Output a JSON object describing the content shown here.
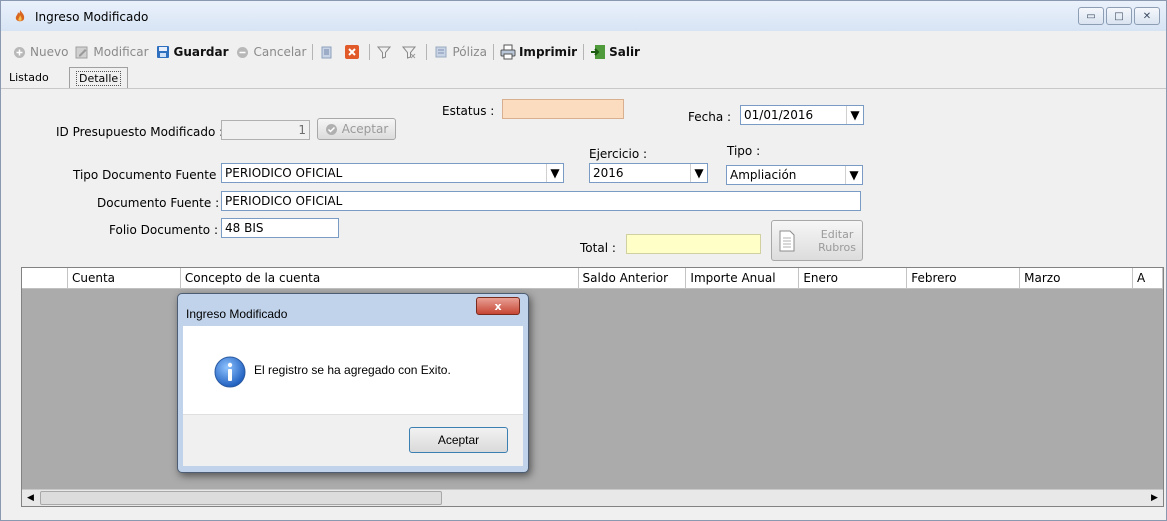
{
  "window": {
    "title": "Ingreso Modificado",
    "icon": "app-flame-icon"
  },
  "toolbar": {
    "nuevo": "Nuevo",
    "modificar": "Modificar",
    "guardar": "Guardar",
    "cancelar": "Cancelar",
    "poliza": "Póliza",
    "imprimir": "Imprimir",
    "salir": "Salir"
  },
  "tabs": {
    "listado": "Listado",
    "detalle": "Detalle"
  },
  "form": {
    "estatus_label": "Estatus :",
    "estatus_value": "",
    "fecha_label": "Fecha :",
    "fecha_value": "01/01/2016",
    "id_label": "ID Presupuesto Modificado :",
    "id_value": "1",
    "aceptar_label": "Aceptar",
    "tipo_doc_label": "Tipo Documento Fuente :",
    "tipo_doc_value": "PERIODICO OFICIAL",
    "ejercicio_label": "Ejercicio :",
    "ejercicio_value": "2016",
    "tipo_label": "Tipo :",
    "tipo_value": "Ampliación",
    "doc_fuente_label": "Documento Fuente :",
    "doc_fuente_value": "PERIODICO OFICIAL",
    "folio_label": "Folio Documento :",
    "folio_value": "48 BIS",
    "total_label": "Total :",
    "total_value": "",
    "editar_rubros_line1": "Editar",
    "editar_rubros_line2": "Rubros"
  },
  "grid": {
    "columns": [
      "Cuenta",
      "Concepto de la cuenta",
      "Saldo Anterior",
      "Importe Anual",
      "Enero",
      "Febrero",
      "Marzo",
      "A"
    ]
  },
  "dialog": {
    "title": "Ingreso Modificado",
    "message": "El registro se ha agregado con Exito.",
    "ok_label": "Aceptar",
    "close_glyph": "x"
  },
  "colors": {
    "estatus_bg": "#fcdcbe",
    "total_bg": "#ffffc8",
    "grid_bg": "#ababab",
    "dialog_frame": "#c0d3ea"
  }
}
